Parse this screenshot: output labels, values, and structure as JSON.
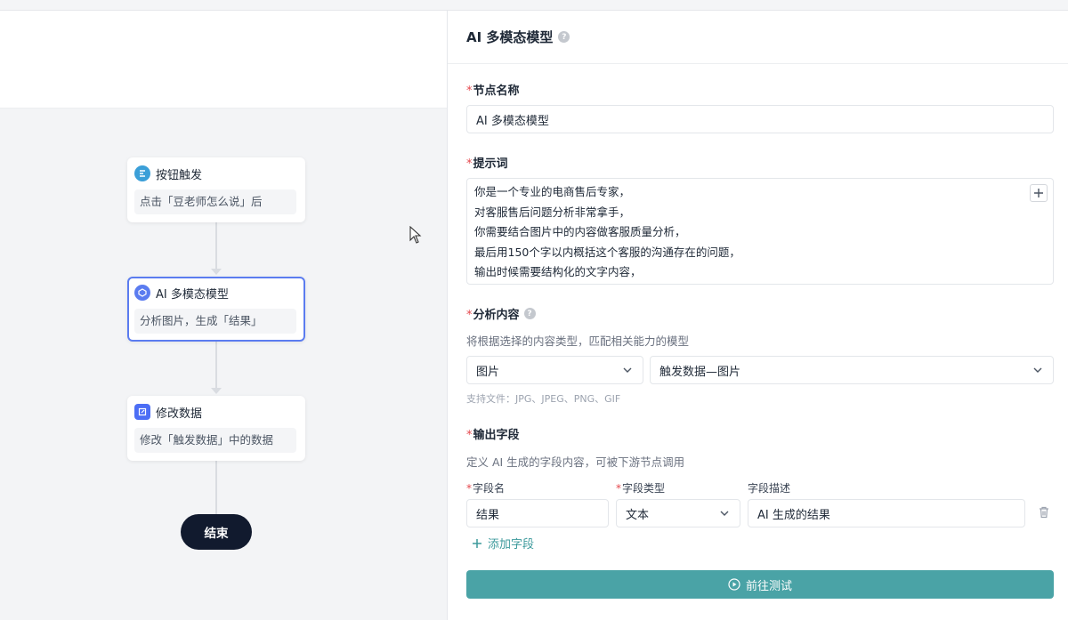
{
  "canvas": {
    "nodes": [
      {
        "title": "按钮触发",
        "desc": "点击「豆老师怎么说」后",
        "icon": "button-trigger-icon",
        "color": "#3b9fd8"
      },
      {
        "title": "AI 多模态模型",
        "desc": "分析图片，生成「结果」",
        "icon": "ai-model-icon",
        "color": "#5b7cf0"
      },
      {
        "title": "修改数据",
        "desc": "修改「触发数据」中的数据",
        "icon": "edit-data-icon",
        "color": "#4c6ef5"
      }
    ],
    "end_label": "结束"
  },
  "panel": {
    "title": "AI 多模态模型",
    "node_name": {
      "label": "节点名称",
      "value": "AI 多模态模型"
    },
    "prompt": {
      "label": "提示词",
      "lines": [
        "你是一个专业的电商售后专家，",
        "对客服售后问题分析非常拿手，",
        "你需要结合图片中的内容做客服质量分析，",
        "最后用150个字以内概括这个客服的沟通存在的问题，",
        "输出时候需要结构化的文字内容，"
      ]
    },
    "analysis": {
      "label": "分析内容",
      "hint": "将根据选择的内容类型，匹配相关能力的模型",
      "type_value": "图片",
      "source_value": "触发数据—图片",
      "support": "支持文件：JPG、JPEG、PNG、GIF"
    },
    "output": {
      "label": "输出字段",
      "hint": "定义 AI 生成的字段内容，可被下游节点调用",
      "col_name": "字段名",
      "col_type": "字段类型",
      "col_desc": "字段描述",
      "field_name": "结果",
      "field_type": "文本",
      "field_desc": "AI 生成的结果",
      "add_label": "添加字段"
    },
    "test_button": "前往测试"
  },
  "colors": {
    "accent": "#4aa3a6",
    "selected_border": "#5b7cf0",
    "required": "#e5484d"
  }
}
